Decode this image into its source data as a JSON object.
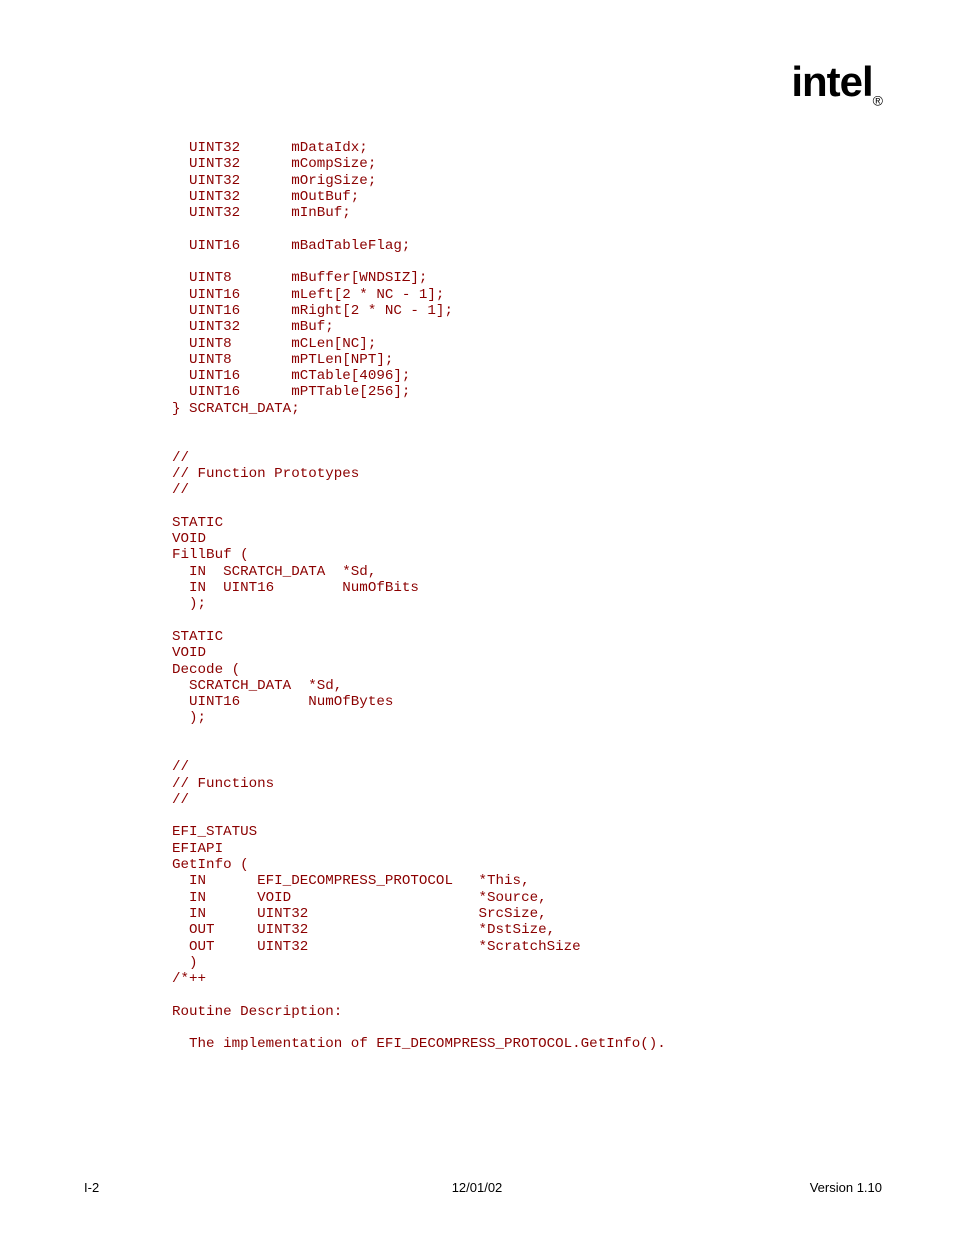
{
  "logo_text": "intel",
  "logo_sub": "®",
  "code": "  UINT32      mDataIdx;\n  UINT32      mCompSize;\n  UINT32      mOrigSize;\n  UINT32      mOutBuf;\n  UINT32      mInBuf;\n\n  UINT16      mBadTableFlag;\n\n  UINT8       mBuffer[WNDSIZ];\n  UINT16      mLeft[2 * NC - 1];\n  UINT16      mRight[2 * NC - 1];\n  UINT32      mBuf;\n  UINT8       mCLen[NC];\n  UINT8       mPTLen[NPT];\n  UINT16      mCTable[4096];\n  UINT16      mPTTable[256];\n} SCRATCH_DATA;\n\n\n//\n// Function Prototypes\n//\n\nSTATIC\nVOID\nFillBuf (\n  IN  SCRATCH_DATA  *Sd,\n  IN  UINT16        NumOfBits\n  );\n\nSTATIC\nVOID\nDecode (\n  SCRATCH_DATA  *Sd,\n  UINT16        NumOfBytes\n  );\n\n\n//\n// Functions\n//\n\nEFI_STATUS\nEFIAPI\nGetInfo (\n  IN      EFI_DECOMPRESS_PROTOCOL   *This,\n  IN      VOID                      *Source,\n  IN      UINT32                    SrcSize,\n  OUT     UINT32                    *DstSize,\n  OUT     UINT32                    *ScratchSize\n  )\n/*++\n\nRoutine Description:\n\n  The implementation of EFI_DECOMPRESS_PROTOCOL.GetInfo().",
  "footer": {
    "left": "I-2",
    "mid": "12/01/02",
    "right": "Version 1.10"
  }
}
